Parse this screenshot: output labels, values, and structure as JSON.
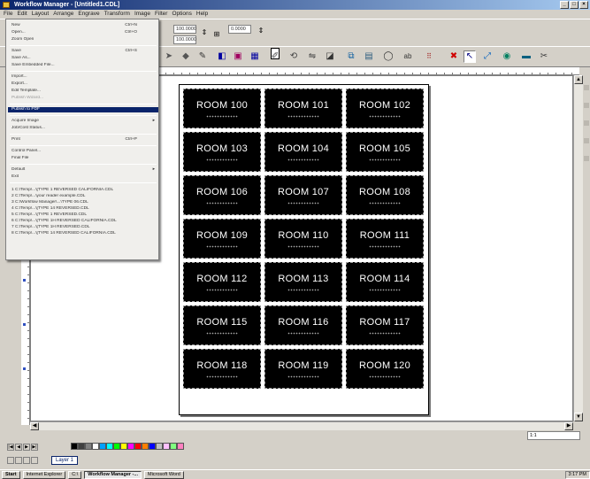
{
  "window": {
    "title": "Workflow Manager - [Untitled1.CDL]"
  },
  "menubar": [
    "File",
    "Edit",
    "Layout",
    "Arrange",
    "Engrave",
    "Transform",
    "Image",
    "Filter",
    "Options",
    "Help"
  ],
  "toolbar": {
    "width_value": "100.0000",
    "height_value": "100.0000",
    "rotation_value": "0.0000"
  },
  "file_menu": {
    "items": [
      {
        "label": "New",
        "shortcut": "Ctrl+N"
      },
      {
        "label": "Open...",
        "shortcut": "Ctrl+O"
      },
      {
        "label": "Zoom Open"
      },
      {
        "label": "Save",
        "shortcut": "Ctrl+S"
      },
      {
        "label": "Save As..."
      },
      {
        "label": "Save Embedded File..."
      },
      {
        "label": "Import..."
      },
      {
        "label": "Export..."
      },
      {
        "label": "Edit Template..."
      },
      {
        "label": "Publish Wizard...",
        "state": "disabled"
      },
      {
        "label": "Publish to PDF",
        "state": "highlighted"
      },
      {
        "label": "Acquire Image",
        "submenu": true
      },
      {
        "label": "Job/Cost Status..."
      },
      {
        "label": "Print",
        "shortcut": "Ctrl+P"
      },
      {
        "label": "Control Panel..."
      },
      {
        "label": "Final File"
      },
      {
        "label": "Default",
        "submenu": true
      },
      {
        "label": "Exit"
      }
    ],
    "recent_files": [
      "1 C:\\Temp\\...\\[TYPE 1 REVERSED CALIFORNIA.CDL",
      "2 C:\\Temp\\...\\your reader example.CDL",
      "3 C:\\Workflow Manager\\...\\TYPE 06.CDL",
      "4 C:\\Temp\\...\\[TYPE 14 REVERSED.CDL",
      "5 C:\\Temp\\...\\[TYPE 1 REVERSED.CDL",
      "6 C:\\Temp\\...\\[TYPE 1H REVERSED CALIFORNIA.CDL",
      "7 C:\\Temp\\...\\[TYPE 1H REVERSED.CDL",
      "8 C:\\Temp\\...\\[TYPE 14 REVERSED CALIFORNIA.CDL"
    ]
  },
  "signs": [
    "ROOM 100",
    "ROOM 101",
    "ROOM 102",
    "ROOM 103",
    "ROOM 104",
    "ROOM 105",
    "ROOM 106",
    "ROOM 107",
    "ROOM 108",
    "ROOM 109",
    "ROOM 110",
    "ROOM 111",
    "ROOM 112",
    "ROOM 113",
    "ROOM 114",
    "ROOM 115",
    "ROOM 116",
    "ROOM 117",
    "ROOM 118",
    "ROOM 119",
    "ROOM 120"
  ],
  "statusbar": {
    "zoom": "1:1",
    "layer": "Layer 1"
  },
  "palette": [
    "#000000",
    "#404040",
    "#808080",
    "#ffffff",
    "#00a0ff",
    "#00ffff",
    "#00ff00",
    "#ffff00",
    "#ff00ff",
    "#ff0000",
    "#ff8000",
    "#0000ff",
    "#c0c0c0",
    "#ffc0ff",
    "#80ff80",
    "#ff80c0"
  ],
  "taskbar": {
    "start": "Start",
    "tasks": [
      "Internet Explorer",
      "C:\\",
      "Workflow Manager -...",
      "Microsoft Word",
      ""
    ],
    "tray_time": "3:17 PM"
  }
}
